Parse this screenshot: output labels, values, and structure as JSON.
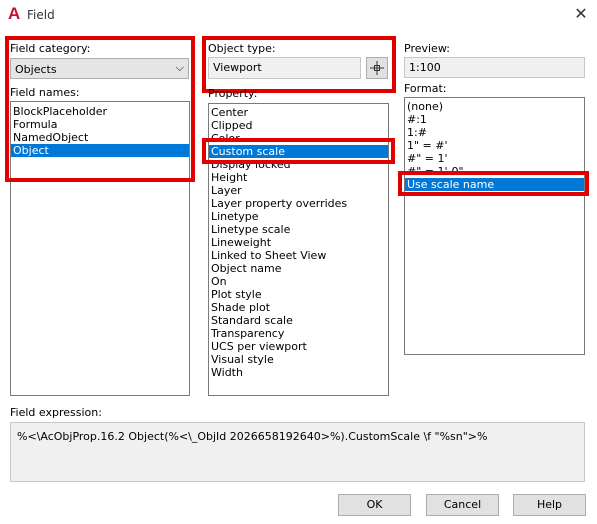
{
  "title_bar": {
    "title": "Field",
    "app_icon": "autocad-a-icon",
    "close_icon": "close-x-icon"
  },
  "field_category": {
    "label": "Field category:",
    "selected": "Objects"
  },
  "field_names": {
    "label": "Field names:",
    "items": [
      "BlockPlaceholder",
      "Formula",
      "NamedObject",
      "Object"
    ],
    "selected_index": 3
  },
  "object_type": {
    "label": "Object type:",
    "value": "Viewport",
    "select_button_icon": "pick-object-crosshair-icon"
  },
  "property": {
    "label": "Property:",
    "items": [
      "Center",
      "Clipped",
      "Color",
      "Custom scale",
      "Display locked",
      "Height",
      "Layer",
      "Layer property overrides",
      "Linetype",
      "Linetype scale",
      "Lineweight",
      "Linked to Sheet View",
      "Object name",
      "On",
      "Plot style",
      "Shade plot",
      "Standard scale",
      "Transparency",
      "UCS per viewport",
      "Visual style",
      "Width"
    ],
    "selected_index": 3
  },
  "preview": {
    "label": "Preview:",
    "value": "1:100"
  },
  "format": {
    "label": "Format:",
    "items": [
      "(none)",
      "#:1",
      "1:#",
      "1\" = #'",
      "#\" = 1'",
      "#\" = 1'-0\"",
      "Use scale name"
    ],
    "selected_index": 6
  },
  "field_expression": {
    "label": "Field expression:",
    "value": "%<\\AcObjProp.16.2 Object(%<\\_ObjId 2026658192640>%).CustomScale \\f \"%sn\">%"
  },
  "buttons": {
    "ok": "OK",
    "cancel": "Cancel",
    "help": "Help"
  },
  "colors": {
    "selection": "#0078d7",
    "highlight": "#e00000",
    "app_icon": "#c8102e"
  }
}
